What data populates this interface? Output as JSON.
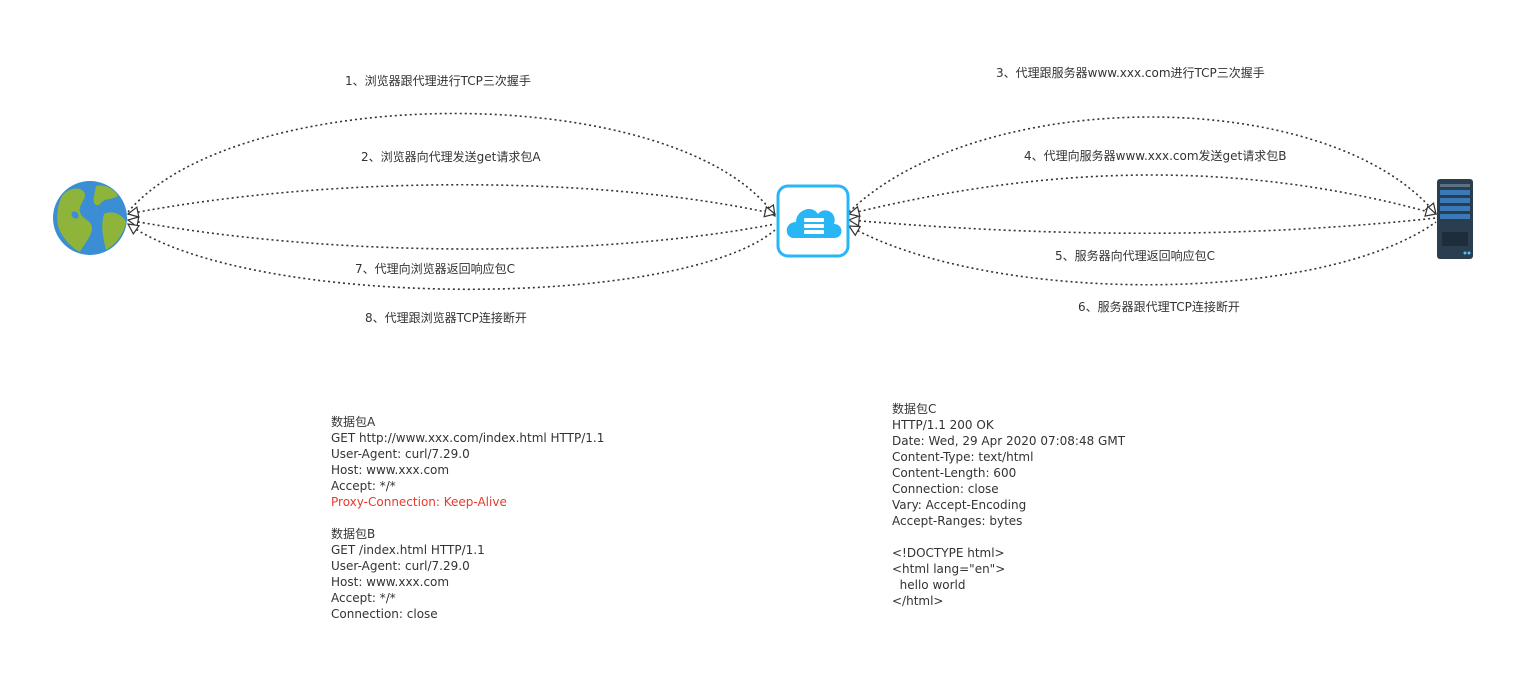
{
  "diagram": {
    "nodes": {
      "browser": {
        "name": "globe-icon"
      },
      "proxy": {
        "name": "cloud-server-icon",
        "accent": "#29b6f6"
      },
      "server": {
        "name": "server-rack-icon",
        "accent": "#2b3e50"
      }
    },
    "edges": {
      "e1": "1、浏览器跟代理进行TCP三次握手",
      "e2": "2、浏览器向代理发送get请求包A",
      "e3": "3、代理跟服务器www.xxx.com进行TCP三次握手",
      "e4": "4、代理向服务器www.xxx.com发送get请求包B",
      "e5": "5、服务器向代理返回响应包C",
      "e6": "6、服务器跟代理TCP连接断开",
      "e7": "7、代理向浏览器返回响应包C",
      "e8": "8、代理跟浏览器TCP连接断开"
    },
    "packetA": {
      "lines": [
        "数据包A",
        "GET http://www.xxx.com/index.html HTTP/1.1",
        "User-Agent: curl/7.29.0",
        "Host: www.xxx.com",
        "Accept: */*"
      ],
      "highlight": "Proxy-Connection: Keep-Alive",
      "highlight_color": "#e8392d"
    },
    "packetB": {
      "lines": [
        "数据包B",
        "GET /index.html HTTP/1.1",
        "User-Agent: curl/7.29.0",
        "Host: www.xxx.com",
        "Accept: */*",
        "Connection: close"
      ]
    },
    "packetC": {
      "headers": [
        "数据包C",
        "HTTP/1.1 200 OK",
        "Date: Wed, 29 Apr 2020 07:08:48 GMT",
        "Content-Type: text/html",
        "Content-Length: 600",
        "Connection: close",
        "Vary: Accept-Encoding",
        "Accept-Ranges: bytes"
      ],
      "body": [
        "<!DOCTYPE html>",
        "<html lang=\"en\">",
        "  hello world",
        "</html>"
      ]
    }
  }
}
